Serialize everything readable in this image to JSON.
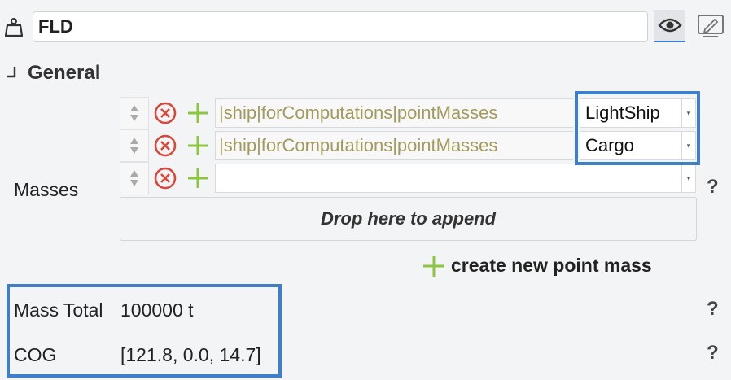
{
  "header": {
    "name_value": "FLD"
  },
  "section": {
    "title": "General"
  },
  "masses": {
    "label": "Masses",
    "rows": [
      {
        "path": "|ship|forComputations|pointMasses",
        "selected": "LightShip"
      },
      {
        "path": "|ship|forComputations|pointMasses",
        "selected": "Cargo"
      },
      {
        "path": "",
        "selected": ""
      }
    ],
    "drop_text": "Drop here to append",
    "create_label": "create new point mass",
    "help": "?"
  },
  "properties": {
    "mass_total_label": "Mass Total",
    "mass_total_value": "100000 t",
    "cog_label": "COG",
    "cog_value": "[121.8, 0.0, 14.7]",
    "help": "?"
  },
  "colors": {
    "highlight": "#3f7ec8",
    "remove": "#d9473a",
    "add": "#8cc63f",
    "path_text": "#a39a5e"
  },
  "icons": {
    "header": [
      "weight-icon",
      "eye-icon",
      "edit-icon"
    ],
    "row": [
      "reorder-icon",
      "remove-icon",
      "add-icon",
      "chevron-down-icon"
    ]
  }
}
